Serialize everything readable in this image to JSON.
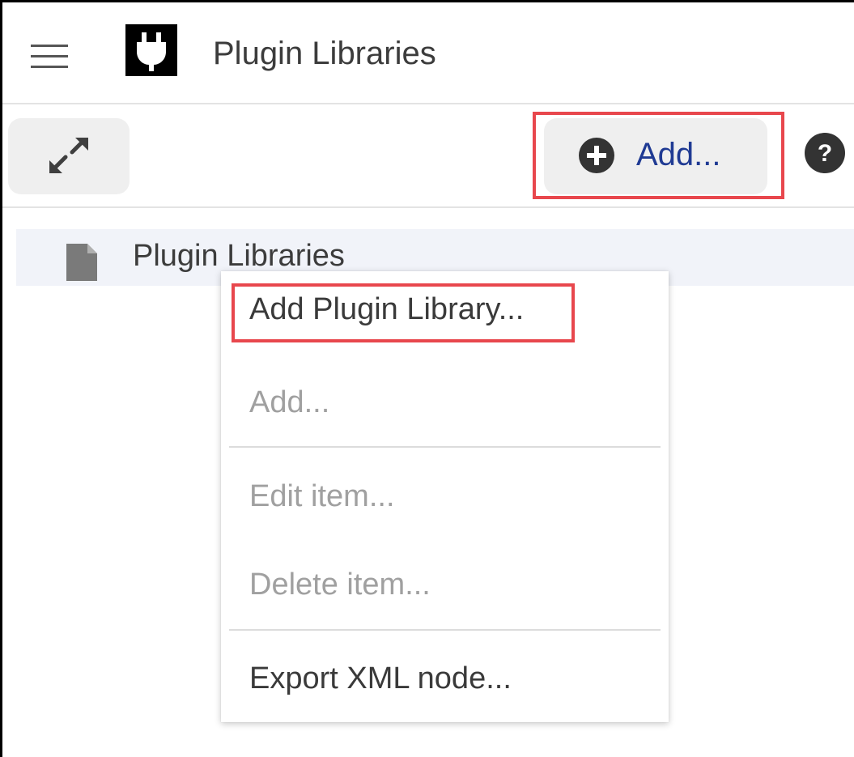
{
  "header": {
    "menu_icon": "hamburger-icon",
    "logo_icon": "plug-icon",
    "title": "Plugin Libraries"
  },
  "toolbar": {
    "expand_icon": "expand-arrows-icon",
    "add_label": "Add...",
    "add_icon": "plus-circle-icon",
    "help_icon": "help-icon"
  },
  "tree": {
    "items": [
      {
        "label": "Plugin Libraries",
        "icon": "file-icon"
      }
    ]
  },
  "context_menu": {
    "items": [
      {
        "label": "Add Plugin Library...",
        "enabled": true
      },
      {
        "label": "Add...",
        "enabled": false
      },
      {
        "label": "Edit item...",
        "enabled": false
      },
      {
        "label": "Delete item...",
        "enabled": false
      },
      {
        "label": "Export XML node...",
        "enabled": true
      }
    ]
  },
  "colors": {
    "highlight": "#e8474d",
    "accent_text": "#1f3a93",
    "selected_row": "#f1f3f9"
  }
}
